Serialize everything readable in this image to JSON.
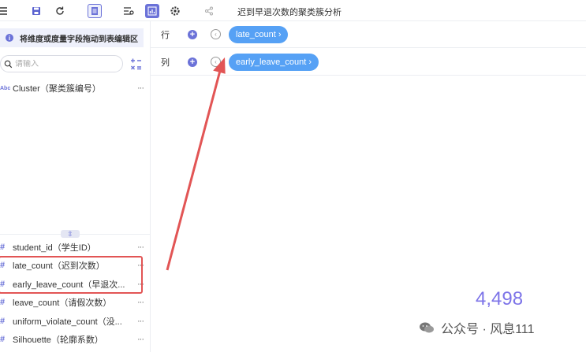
{
  "toolbar": {
    "title": "迟到早退次数的聚类簇分析",
    "icons": [
      "menu-icon",
      "save-icon",
      "refresh-icon",
      "document-icon",
      "filter-settings-icon",
      "chart-icon",
      "gear-icon",
      "share-icon"
    ]
  },
  "left_panel": {
    "hint": "将维度或度量字段拖动到表编辑区",
    "search_placeholder": "请输入",
    "dimensions": [
      {
        "type": "Abc",
        "name": "Cluster（聚类簇编号）"
      }
    ],
    "measures": [
      {
        "type": "#",
        "name": "student_id（学生ID）"
      },
      {
        "type": "#",
        "name": "late_count（迟到次数）"
      },
      {
        "type": "#",
        "name": "early_leave_count（早退次..."
      },
      {
        "type": "#",
        "name": "leave_count（请假次数）"
      },
      {
        "type": "#",
        "name": "uniform_violate_count（没..."
      },
      {
        "type": "#",
        "name": "Silhouette（轮廓系数）"
      }
    ],
    "more_label": "···"
  },
  "rows_shelf": {
    "label": "行",
    "pill": "late_count ›"
  },
  "cols_shelf": {
    "label": "列",
    "pill": "early_leave_count ›"
  },
  "result_value": "4,498",
  "watermark": "公众号 · 风息111",
  "colors": {
    "accent": "#6b72d8",
    "pill": "#56a1f5",
    "highlight": "#e25555",
    "value": "#7d74e8"
  }
}
